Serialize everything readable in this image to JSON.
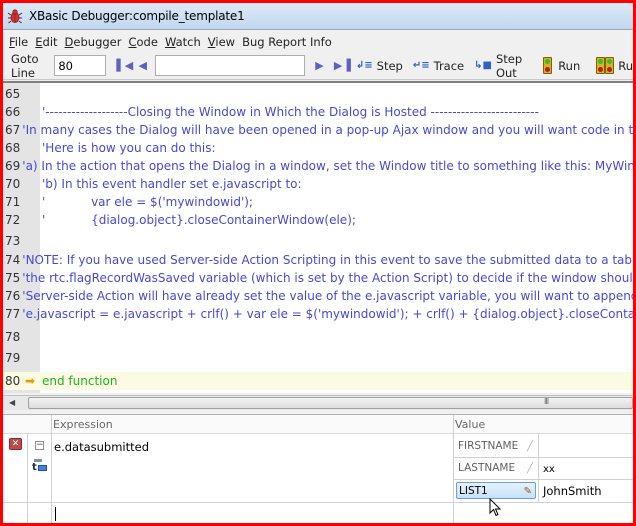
{
  "window": {
    "title": "XBasic Debugger:compile_template1",
    "icon": "bug-icon"
  },
  "menu": [
    {
      "label": "File",
      "accel": "F",
      "rest": "ile"
    },
    {
      "label": "Edit",
      "accel": "E",
      "rest": "dit"
    },
    {
      "label": "Debugger",
      "accel": "D",
      "rest": "ebugger"
    },
    {
      "label": "Code",
      "accel": "C",
      "rest": "ode"
    },
    {
      "label": "Watch",
      "accel": "W",
      "rest": "atch"
    },
    {
      "label": "View",
      "accel": "V",
      "rest": "iew"
    },
    {
      "label": "Bug Report Info",
      "accel": "",
      "rest": "Bug Report Info"
    }
  ],
  "toolbar": {
    "goto_label": "Goto Line",
    "goto_value": "80",
    "search_value": "",
    "first_icon": "skip-to-start-icon",
    "prev_icon": "previous-icon",
    "next_icon": "next-icon",
    "last_icon": "skip-to-end-icon",
    "step_label": "Step",
    "trace_label": "Trace",
    "step_out_label": "Step Out",
    "run_label": "Run",
    "run_all_label": "Ru"
  },
  "editor": {
    "lines": [
      {
        "num": "65",
        "text": ""
      },
      {
        "num": "66",
        "text": "'-------------------Closing the Window in Which the Dialog is Hosted -------------------------"
      },
      {
        "num": "67",
        "text": "'In many cases the Dialog will have been opened in a pop-up Ajax window and you will want code in th"
      },
      {
        "num": "68",
        "text": "'Here is how you can do this:"
      },
      {
        "num": "69",
        "text": "'a) In the action that opens the Dialog in a window, set the Window title to something like this: MyWind"
      },
      {
        "num": "70",
        "text": "'b) In this event handler set e.javascript to:"
      },
      {
        "num": "71",
        "text": "'            var ele = $('mywindowid');"
      },
      {
        "num": "72",
        "text": "'            {dialog.object}.closeContainerWindow(ele);"
      },
      {
        "num": "73",
        "text": ""
      },
      {
        "num": "74",
        "text": "'NOTE: If you have used Server-side Action Scripting in this event to save the submitted data to a table"
      },
      {
        "num": "75",
        "text": "'the rtc.flagRecordWasSaved variable (which is set by the Action Script) to decide if the window should"
      },
      {
        "num": "76",
        "text": "'Server-side Action will have already set the value of the e.javascript variable, you will want to append"
      },
      {
        "num": "77",
        "text": "'e.javascript = e.javascript + crlf() + var ele = $('mywindowid'); + crlf() + {dialog.object}.closeContain"
      },
      {
        "num": "78",
        "text": ""
      },
      {
        "num": "79",
        "text": ""
      },
      {
        "num": "80",
        "text": "end function",
        "current": true
      }
    ],
    "scroll_grip": "III"
  },
  "watch": {
    "headers": {
      "expression": "Expression",
      "value": "Value"
    },
    "expression": "e.datasubmitted",
    "fields": [
      {
        "name": "FIRSTNAME",
        "value": ""
      },
      {
        "name": "LASTNAME",
        "value": "xx"
      },
      {
        "name": "LIST1",
        "value": "JohnSmith",
        "selected": true
      }
    ],
    "new_expression": ""
  }
}
